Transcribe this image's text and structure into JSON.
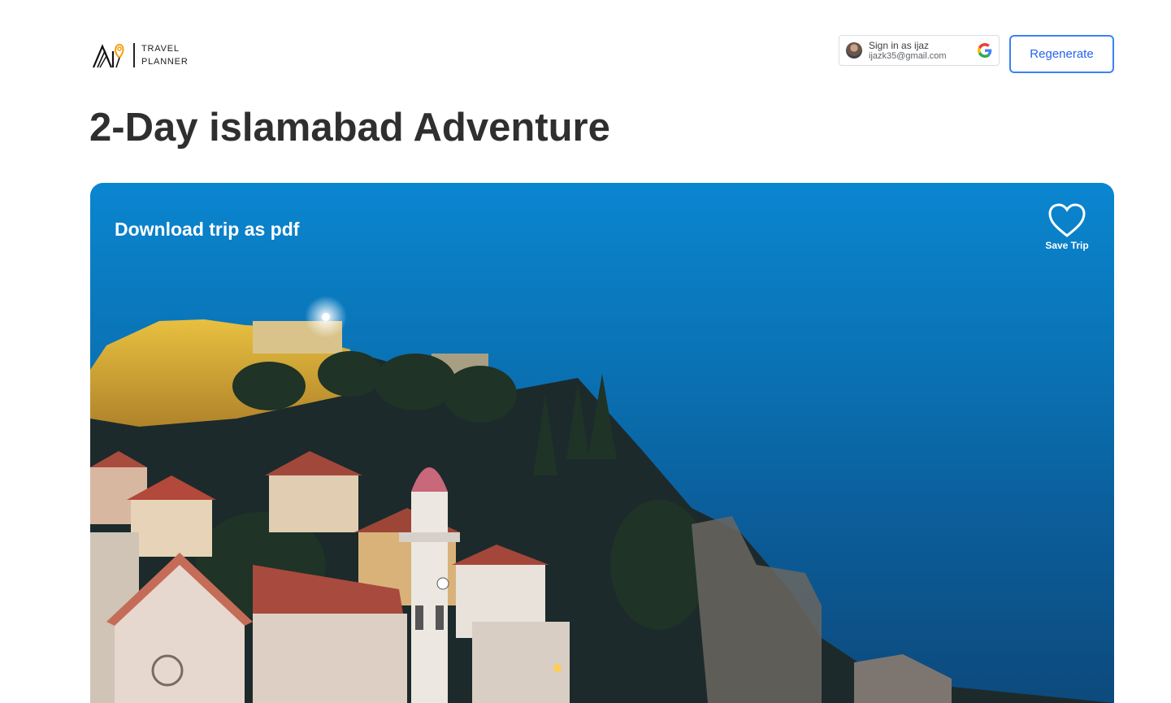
{
  "brand": {
    "line1": "TRAVEL",
    "line2": "PLANNER",
    "logo_icon": "ai-pin-logo"
  },
  "auth": {
    "signed_in_label": "Sign in as ijaz",
    "email": "ijazk35@gmail.com",
    "provider_icon": "google-icon"
  },
  "toolbar": {
    "regenerate_label": "Regenerate"
  },
  "trip": {
    "title": "2-Day islamabad Adventure",
    "download_label": "Download trip as pdf",
    "save_label": "Save Trip",
    "save_icon": "heart-icon"
  },
  "colors": {
    "accent": "#3b82f6",
    "title": "#2f2f2f",
    "sky": "#0a7fc6"
  }
}
